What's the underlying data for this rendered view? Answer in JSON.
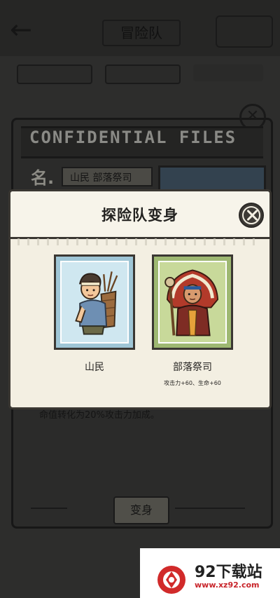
{
  "background": {
    "title": "冒险队",
    "confidential_header": "CONFIDENTIAL   FILES",
    "name_label": "名.",
    "name_value": "山民 部落祭司",
    "description": "命值转化为20%攻击力加成。",
    "transform_button": "变身"
  },
  "modal": {
    "title": "探险队变身",
    "options": [
      {
        "name": "山民",
        "stats": ""
      },
      {
        "name": "部落祭司",
        "stats": "攻击力+60、生命+60"
      }
    ]
  },
  "watermark": {
    "brand": "92下载站",
    "url": "www.xz92.com"
  },
  "colors": {
    "modal_bg": "#f3efe2",
    "border": "#3a3732",
    "card_blue": "#9fc6d6",
    "card_green": "#9eb872",
    "watermark_red": "#c8242a"
  }
}
